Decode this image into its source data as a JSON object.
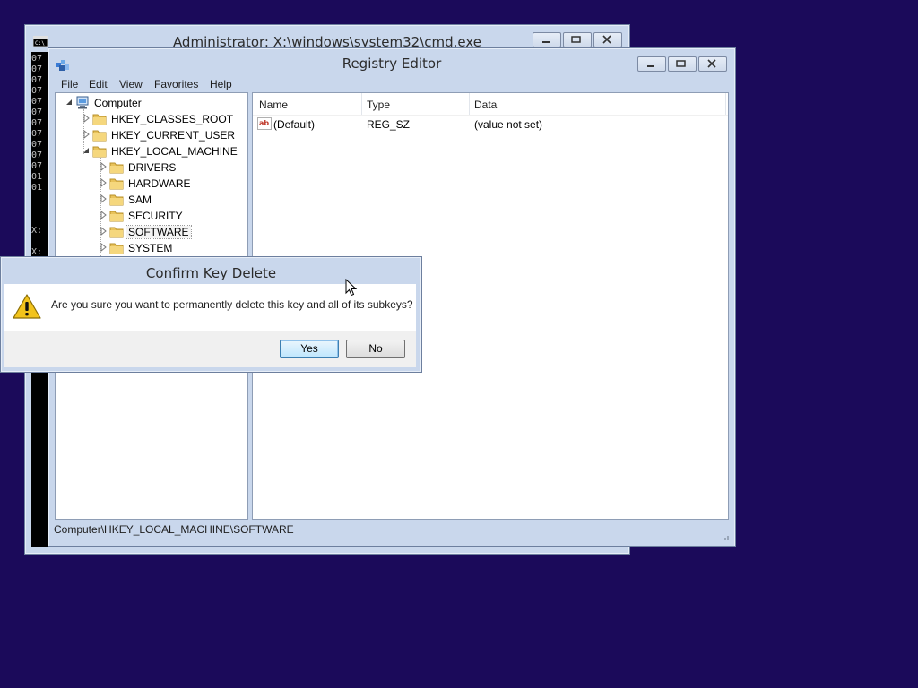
{
  "cmd": {
    "title": "Administrator: X:\\windows\\system32\\cmd.exe",
    "lines": [
      "07",
      "07",
      "07",
      "07",
      "07",
      "07",
      "07",
      "07",
      "07",
      "07",
      "07",
      "01",
      "01"
    ],
    "prompt1": "X:",
    "prompt2": "X:"
  },
  "regedit": {
    "title": "Registry Editor",
    "menu": [
      "File",
      "Edit",
      "View",
      "Favorites",
      "Help"
    ],
    "tree": {
      "root": "Computer",
      "hives": [
        "HKEY_CLASSES_ROOT",
        "HKEY_CURRENT_USER",
        "HKEY_LOCAL_MACHINE"
      ],
      "hklm_children": [
        "DRIVERS",
        "HARDWARE",
        "SAM",
        "SECURITY",
        "SOFTWARE",
        "SYSTEM"
      ],
      "selected": "SOFTWARE"
    },
    "columns": [
      "Name",
      "Type",
      "Data"
    ],
    "values": [
      {
        "name": "(Default)",
        "type": "REG_SZ",
        "data": "(value not set)"
      }
    ],
    "status": "Computer\\HKEY_LOCAL_MACHINE\\SOFTWARE"
  },
  "dialog": {
    "title": "Confirm Key Delete",
    "message": "Are you sure you want to permanently delete this key and all of its subkeys?",
    "yes": "Yes",
    "no": "No"
  },
  "colors": {
    "desktop": "#1b0a5a",
    "frame": "#c9d7ec",
    "default_button": "#3c7fb1"
  }
}
